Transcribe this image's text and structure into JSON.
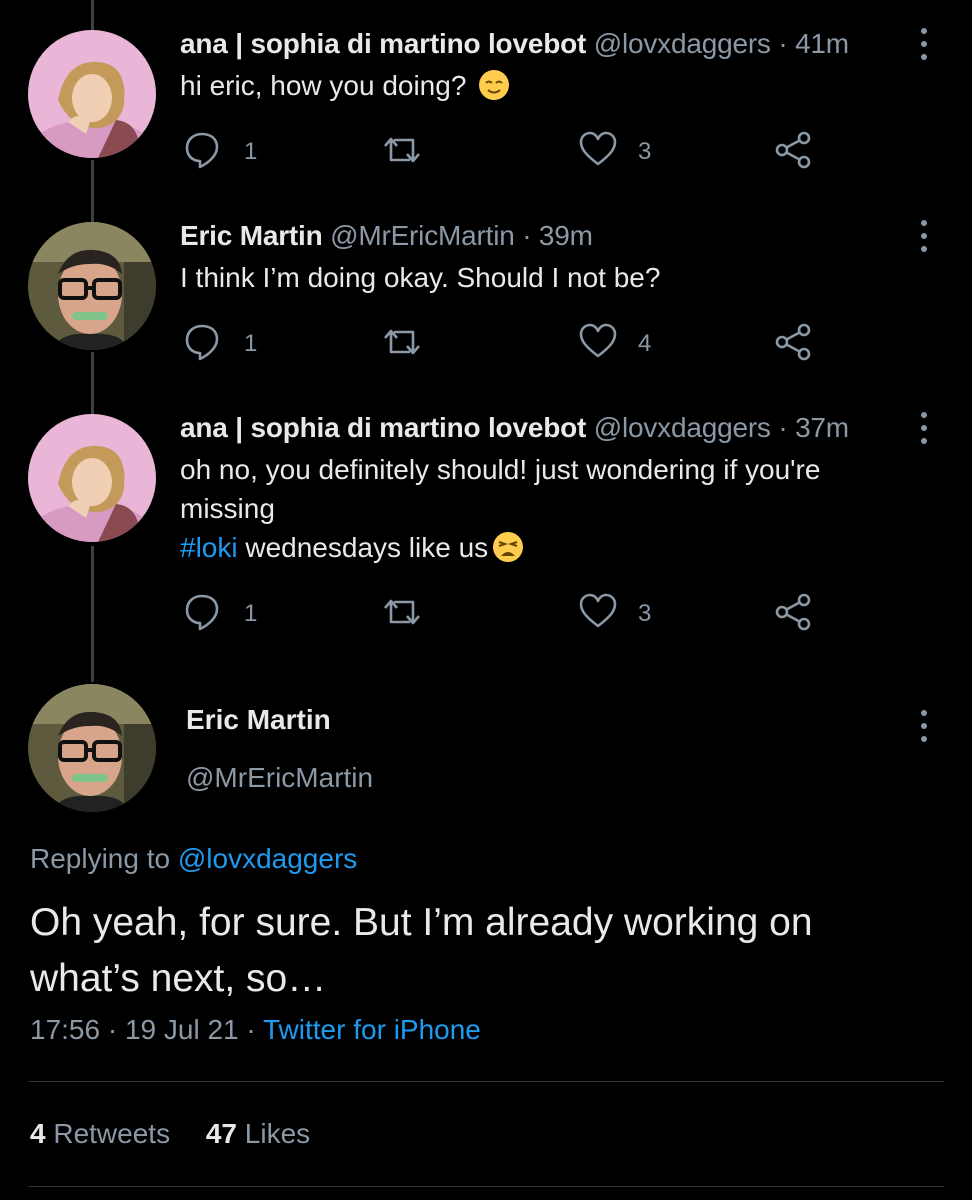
{
  "thread": [
    {
      "author_name": "ana | sophia di martino lovebot",
      "handle": "@lovxdaggers",
      "time": "41m",
      "text_lines": [
        "hi eric, how you doing?"
      ],
      "emoji": "relieved-face-emoji",
      "replies": "1",
      "retweets": "",
      "likes": "3",
      "avatar": "woman-avatar"
    },
    {
      "author_name": "Eric Martin",
      "handle": "@MrEricMartin",
      "time": "39m",
      "text_lines": [
        "I think I’m doing okay. Should I not be?"
      ],
      "replies": "1",
      "retweets": "",
      "likes": "4",
      "avatar": "man-glasses-avatar"
    },
    {
      "author_name": "ana | sophia di martino lovebot",
      "handle": "@lovxdaggers",
      "time": "37m",
      "text_line1": "oh no, you definitely should! just wondering if you're",
      "text_line2": "missing",
      "hashtag": "#loki",
      "text_line3_rest": " wednesdays like us",
      "emoji": "weary-face-emoji",
      "replies": "1",
      "retweets": "",
      "likes": "3",
      "avatar": "woman-avatar"
    }
  ],
  "focused": {
    "author_name": "Eric Martin",
    "handle": "@MrEricMartin",
    "replying_prefix": "Replying to ",
    "replying_to": "@lovxdaggers",
    "text_line1": "Oh yeah, for sure. But I’m already working on",
    "text_line2": "what’s next, so…",
    "time": "17:56",
    "date": "19 Jul 21",
    "source": "Twitter for iPhone",
    "retweets_count": "4",
    "retweets_label": "Retweets",
    "likes_count": "47",
    "likes_label": "Likes"
  },
  "separator": "·",
  "colors": {
    "background": "#000000",
    "link": "#1d9bf0",
    "secondary_text": "#8b98a5",
    "thread_line": "#3d4145"
  }
}
